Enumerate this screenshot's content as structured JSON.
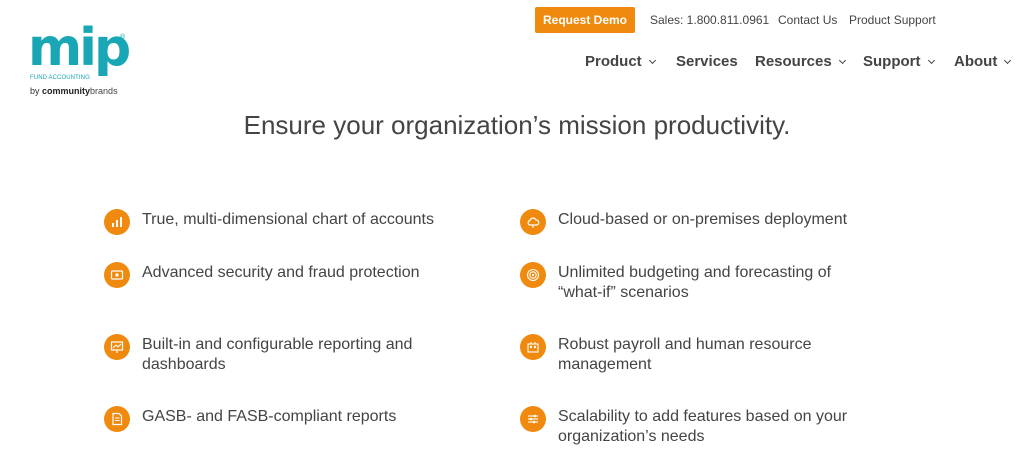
{
  "logo": {
    "brand": "mip",
    "registered": "®",
    "tagline": "FUND ACCOUNTING",
    "by": "by",
    "company_bold": "community",
    "company_rest": "brands"
  },
  "utility": {
    "request_demo": "Request Demo",
    "sales": "Sales: 1.800.811.0961",
    "contact": "Contact Us",
    "support": "Product Support"
  },
  "nav": {
    "product": "Product",
    "services": "Services",
    "resources": "Resources",
    "support": "Support",
    "about": "About"
  },
  "headline": "Ensure your organization’s mission productivity.",
  "features": {
    "left": [
      {
        "text": "True, multi-dimensional chart of accounts",
        "icon": "chart-icon"
      },
      {
        "text": "Advanced security and fraud protection",
        "icon": "security-icon"
      },
      {
        "text": "Built-in and configurable reporting and dashboards",
        "icon": "dashboard-icon"
      },
      {
        "text": "GASB- and FASB-compliant reports",
        "icon": "document-icon"
      }
    ],
    "right": [
      {
        "text": "Cloud-based or on-premises deployment",
        "icon": "cloud-icon"
      },
      {
        "text": "Unlimited budgeting and forecasting of “what-if” scenarios",
        "icon": "target-icon"
      },
      {
        "text": "Robust payroll and human resource management",
        "icon": "people-icon"
      },
      {
        "text": "Scalability to add features based on your organization’s needs",
        "icon": "sliders-icon"
      }
    ]
  },
  "colors": {
    "accent": "#ef8a0f",
    "brand": "#19a7b5",
    "text": "#444444"
  }
}
